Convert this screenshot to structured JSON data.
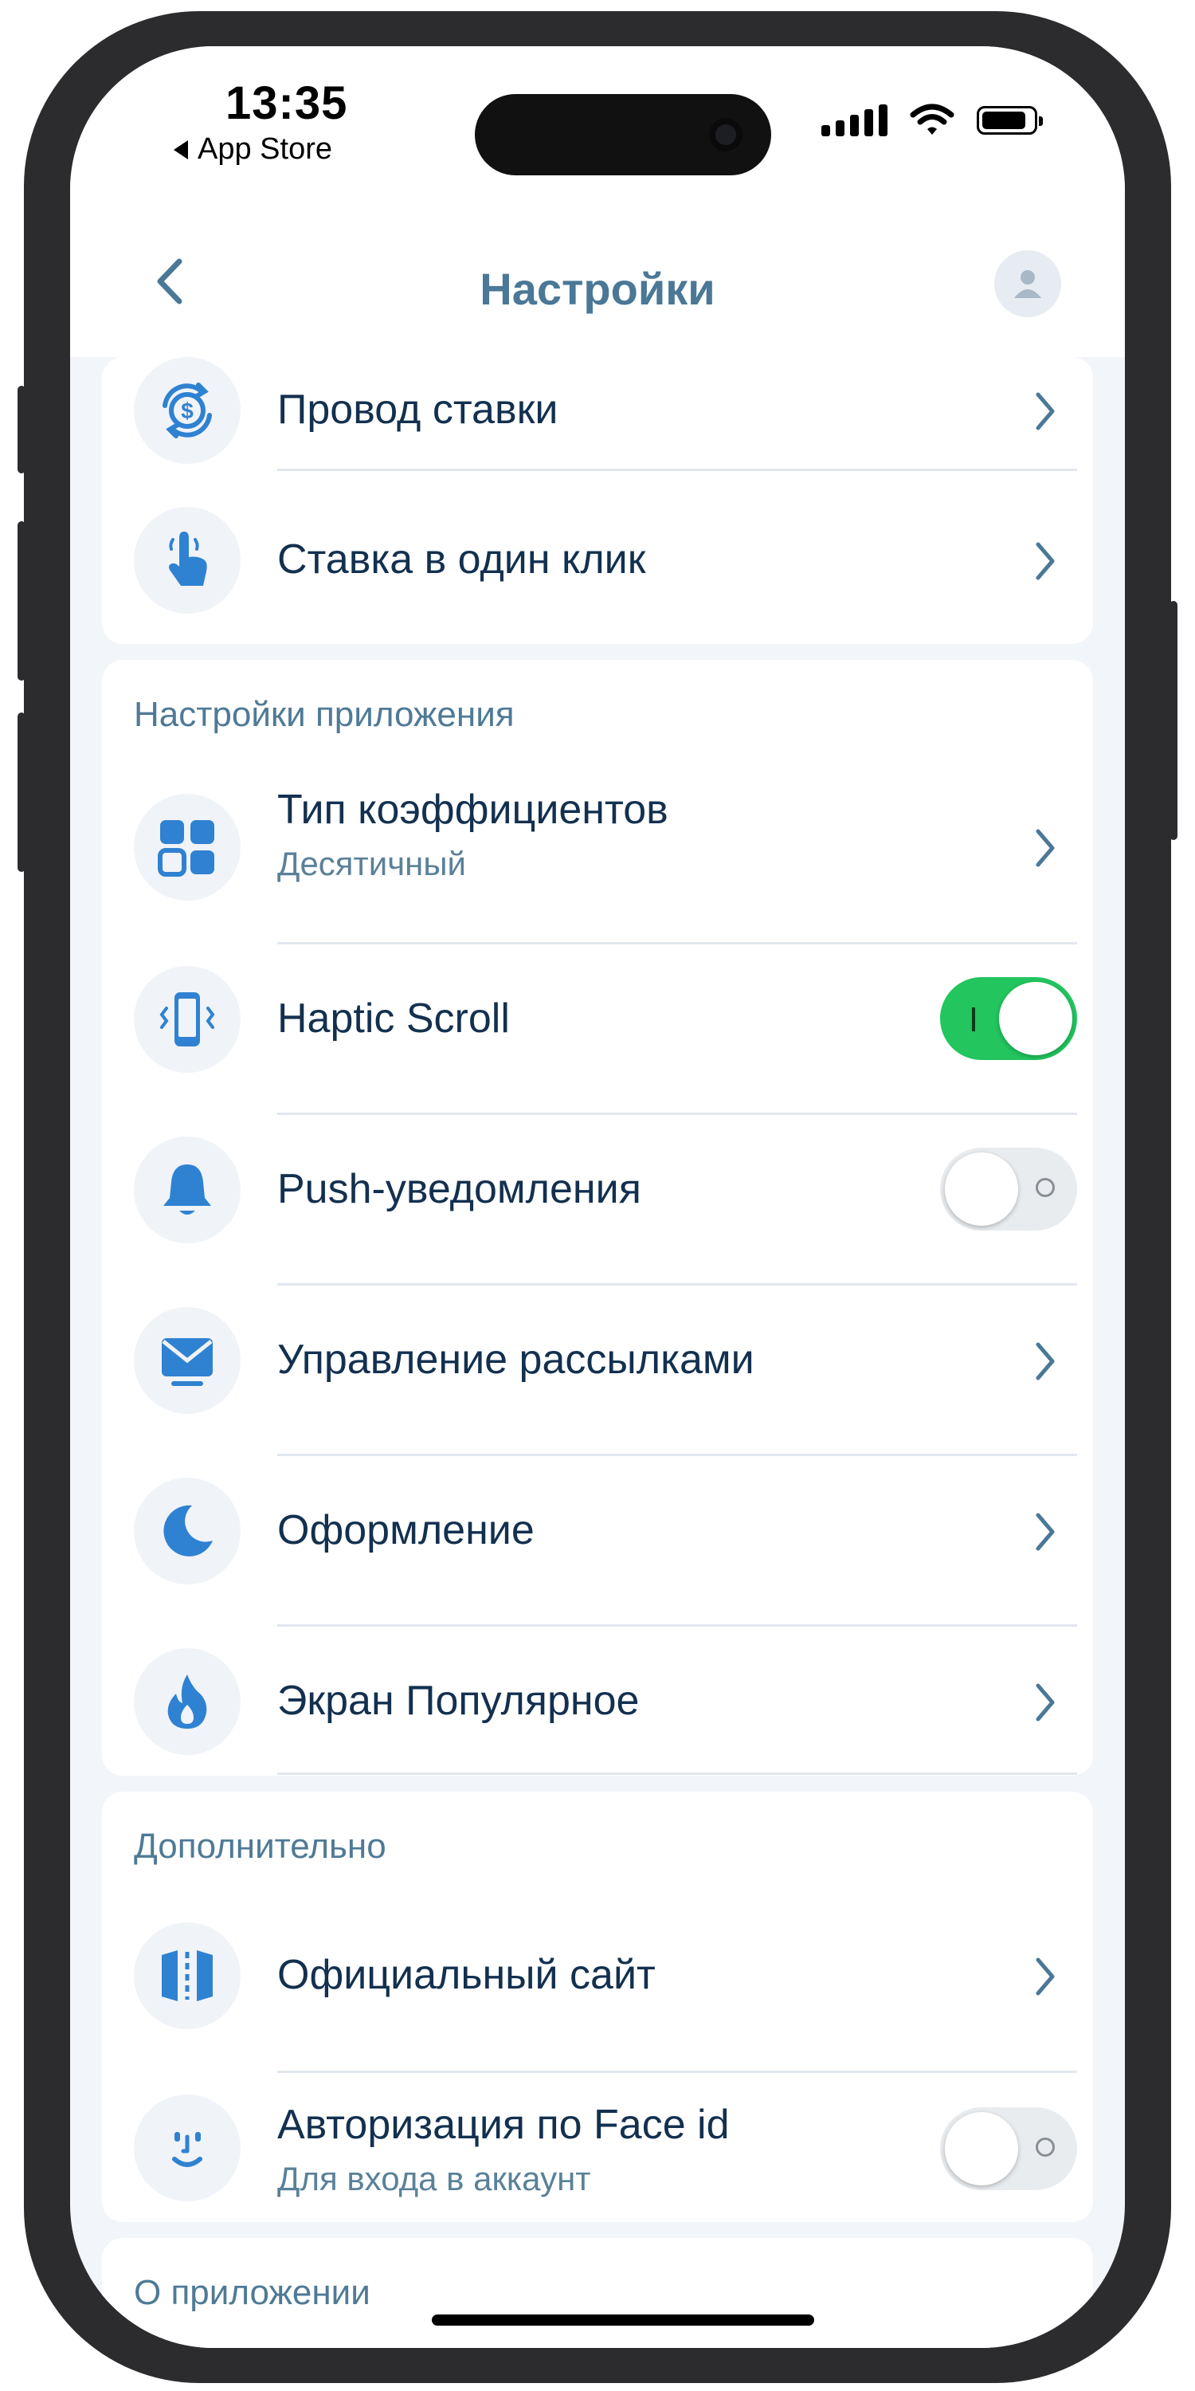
{
  "status_bar": {
    "time": "13:35",
    "back_app": "App Store"
  },
  "navbar": {
    "title": "Настройки"
  },
  "sections": {
    "top": {
      "items": [
        {
          "label": "Провод ставки",
          "icon": "dollar-refresh-icon"
        },
        {
          "label": "Ставка в один клик",
          "icon": "tap-finger-icon"
        }
      ]
    },
    "app_settings": {
      "title": "Настройки приложения",
      "items": [
        {
          "label": "Тип коэффициентов",
          "sub": "Десятичный",
          "icon": "grid-icon"
        },
        {
          "label": "Haptic Scroll",
          "icon": "phone-vibrate-icon",
          "toggle": "on"
        },
        {
          "label": "Push-уведомления",
          "icon": "bell-icon",
          "toggle": "off"
        },
        {
          "label": "Управление рассылками",
          "icon": "mail-icon"
        },
        {
          "label": "Оформление",
          "icon": "moon-icon"
        },
        {
          "label": "Экран Популярное",
          "icon": "flame-icon"
        }
      ]
    },
    "extra": {
      "title": "Дополнительно",
      "items": [
        {
          "label": "Официальный сайт",
          "icon": "map-icon"
        },
        {
          "label": "Авторизация по Face id",
          "sub": "Для входа в аккаунт",
          "icon": "face-id-icon",
          "toggle": "off"
        }
      ]
    },
    "about": {
      "title": "О приложении"
    }
  },
  "colors": {
    "accent_blue": "#2f82d1",
    "title_blue": "#4a7896",
    "text_dark": "#13304f",
    "toggle_on": "#22c55e"
  }
}
